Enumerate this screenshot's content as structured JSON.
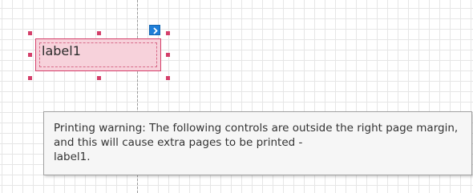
{
  "designer": {
    "control": {
      "label": "label1"
    },
    "smart_tag": {
      "icon": "chevron-right-icon",
      "color": "#1f7ed8"
    },
    "tooltip": {
      "text": "Printing warning: The following controls are outside the right page margin, and this will cause extra pages to be printed -\nlabel1."
    }
  },
  "colors": {
    "selection": "#d43f6a",
    "control_fill": "#f7d2db",
    "grid": "#e6e6e6"
  }
}
